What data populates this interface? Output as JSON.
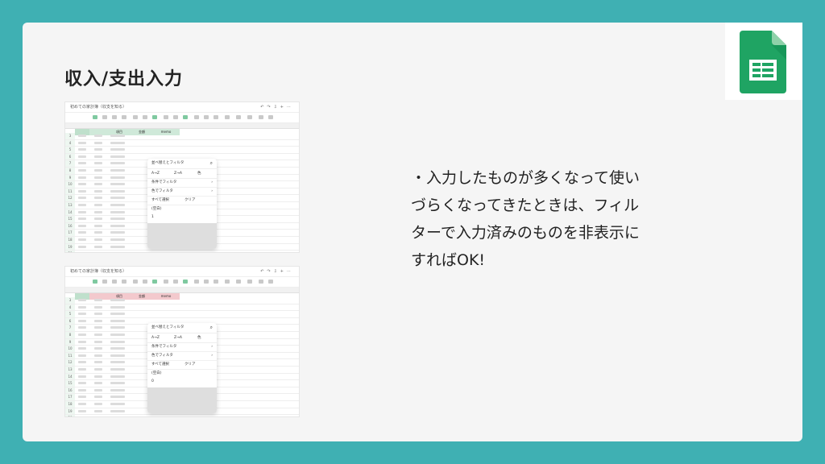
{
  "slide": {
    "title": "収入/支出入力",
    "body_lines": [
      "・入力したものが多くなって使い",
      "づらくなってきたときは、フィル",
      "ターで入力済みのものを非表示に",
      "すればOK!"
    ]
  },
  "logo": {
    "icon": "google-sheets-icon",
    "colors": {
      "green": "#1fa463",
      "dark_green": "#0f8a4f",
      "light_green": "#8ed1a9",
      "white": "#ffffff"
    }
  },
  "screenshot1": {
    "doc_title": "初めての家計簿（収支を知る）",
    "panel": {
      "header": "並べ替えとフィルタ",
      "sort_az": "A→Z",
      "sort_za": "Z→A",
      "sort_color": "色",
      "filter_condition": "条件でフィルタ",
      "filter_value": "色でフィルタ",
      "select_all": "すべて選択",
      "clear": "クリア",
      "blank_item": "(空白)",
      "value_item": "1"
    }
  },
  "screenshot2": {
    "doc_title": "初めての家計簿（収支を知る）",
    "panel": {
      "header": "並べ替えとフィルタ",
      "sort_az": "A→Z",
      "sort_za": "Z→A",
      "sort_color": "色",
      "filter_condition": "条件でフィルタ",
      "filter_value": "色でフィルタ",
      "select_all": "すべて選択",
      "clear": "クリア",
      "blank_item": "(空白)",
      "value_item": "0"
    }
  },
  "column_headers": {
    "item": "項目",
    "amount": "金額",
    "memo": "memo"
  },
  "colors": {
    "background": "#3fb0b3",
    "card": "#f5f5f5",
    "header_green": "#cfe9d9",
    "header_red": "#f3c9cd"
  }
}
